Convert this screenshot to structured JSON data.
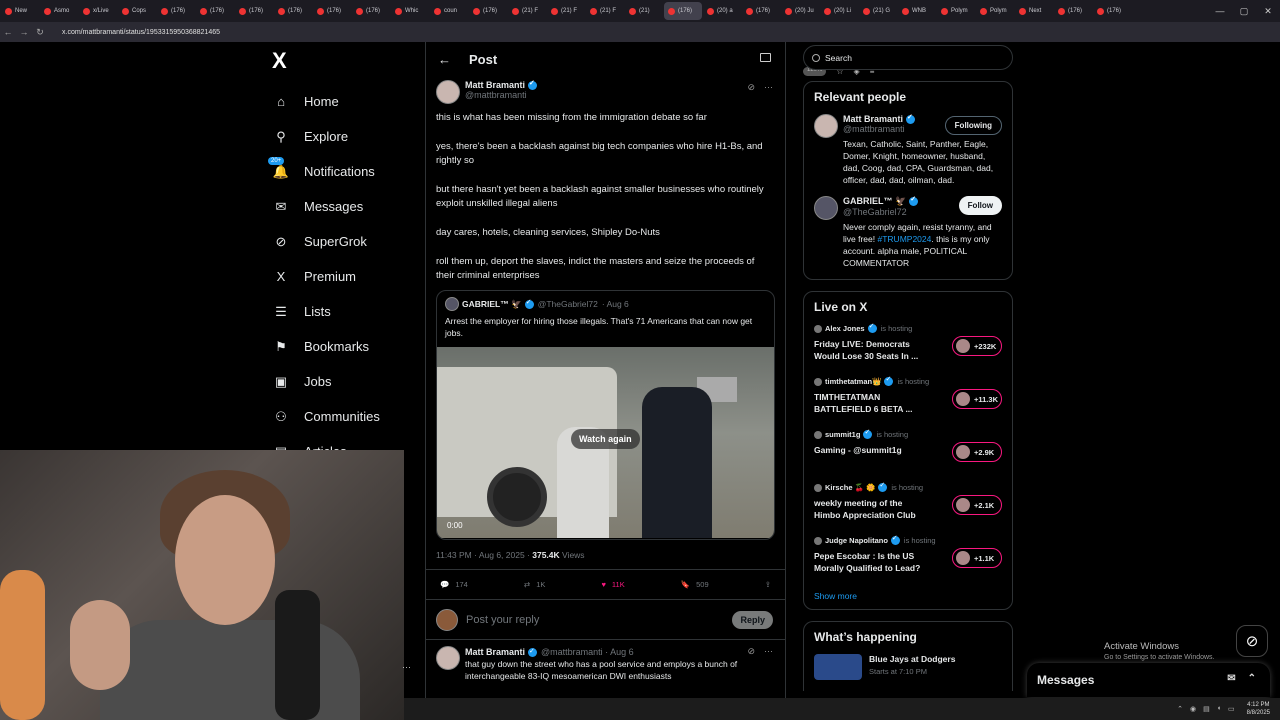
{
  "browser": {
    "tabs": [
      "New",
      "Asmo",
      "x/Live",
      "Cops",
      "(176)",
      "(176)",
      "(176)",
      "(176)",
      "(176)",
      "(176)",
      "Whic",
      "coun",
      "(176)",
      "(21) F",
      "(21) F",
      "(21) F",
      "(21)",
      "(176)",
      "(20) a",
      "(176)",
      "(20) Ju",
      "(20) Li",
      "(21) G",
      "WNB",
      "Polym",
      "Polym",
      "Next",
      "(176)",
      "(176)"
    ],
    "active_tab_index": 17,
    "url": "x.com/mattbramanti/status/1953315950368821465",
    "zoom": "120%"
  },
  "nav": {
    "logo": "X",
    "items": [
      {
        "label": "Home",
        "icon": "home-icon"
      },
      {
        "label": "Explore",
        "icon": "search-icon"
      },
      {
        "label": "Notifications",
        "icon": "bell-icon",
        "badge": "20+"
      },
      {
        "label": "Messages",
        "icon": "envelope-icon"
      },
      {
        "label": "SuperGrok",
        "icon": "grok-icon"
      },
      {
        "label": "Premium",
        "icon": "x-logo-icon"
      },
      {
        "label": "Lists",
        "icon": "list-icon"
      },
      {
        "label": "Bookmarks",
        "icon": "bookmark-icon"
      },
      {
        "label": "Jobs",
        "icon": "briefcase-icon"
      },
      {
        "label": "Communities",
        "icon": "people-icon"
      },
      {
        "label": "Articles",
        "icon": "article-icon"
      }
    ]
  },
  "main": {
    "header_title": "Post",
    "author": {
      "name": "Matt Bramanti",
      "handle": "@mattbramanti"
    },
    "paragraphs": [
      "this is what has been missing from the immigration debate so far",
      "yes, there's been a backlash against big tech companies who hire H1-Bs, and rightly so",
      "but there hasn't yet been a backlash against smaller businesses who routinely exploit unskilled illegal aliens",
      "day cares, hotels, cleaning services, Shipley Do-Nuts",
      "roll them up, deport the slaves, indict the masters and seize the proceeds of their criminal enterprises"
    ],
    "quote": {
      "name": "GABRIEL™ 🦅",
      "handle": "@TheGabriel72",
      "date": "· Aug 6",
      "text": "Arrest the employer for hiring those illegals.  That's 71 Americans that can now get jobs.",
      "video_button": "Watch again",
      "video_time": "0:00"
    },
    "meta": {
      "time": "11:43 PM · Aug 6, 2025 · ",
      "views_count": "375.4K",
      "views_label": " Views"
    },
    "stats": {
      "replies": "174",
      "reposts": "1K",
      "likes": "11K",
      "bookmarks": "509"
    },
    "reply_placeholder": "Post your reply",
    "reply_button": "Reply",
    "reply_post": {
      "name": "Matt Bramanti",
      "handle": "@mattbramanti · Aug 6",
      "text": "that guy down the street who has a pool service and employs a bunch of interchangeable 83-IQ mesoamerican DWI enthusiasts"
    }
  },
  "right": {
    "search_placeholder": "Search",
    "relevant_title": "Relevant people",
    "people": [
      {
        "name": "Matt Bramanti",
        "handle": "@mattbramanti",
        "button": "Following",
        "bio": "Texan, Catholic, Saint, Panther, Eagle, Domer, Knight, homeowner, husband, dad, Coog, dad, CPA, Guardsman, dad, officer, dad, dad, oilman, dad."
      },
      {
        "name": "GABRIEL™ 🦅",
        "handle": "@TheGabriel72",
        "button": "Follow",
        "bio_before": "Never comply again, resist tyranny, and live free! ",
        "bio_tag": "#TRUMP2024",
        "bio_after": ". this is my only account. alpha male, POLITICAL COMMENTATOR"
      }
    ],
    "live_title": "Live on X",
    "live": [
      {
        "host": "Alex Jones",
        "status": "is hosting",
        "title": "Friday LIVE: Democrats Would Lose 30 Seats In ...",
        "count": "+232K"
      },
      {
        "host": "timthetatman👑",
        "status": "is hosting",
        "title": "TIMTHETATMAN BATTLEFIELD 6 BETA ...",
        "count": "+11.3K"
      },
      {
        "host": "summit1g",
        "status": "is hosting",
        "title": "Gaming - @summit1g",
        "count": "+2.9K"
      },
      {
        "host": "Kirsche 🍒 🌼",
        "status": "is hosting",
        "title": "weekly meeting of the Himbo Appreciation Club",
        "count": "+2.1K"
      },
      {
        "host": "Judge Napolitano",
        "status": "is hosting",
        "title": "Pepe Escobar : Is the US Morally Qualified to Lead?",
        "count": "+1.1K"
      }
    ],
    "show_more": "Show more",
    "happening_title": "What’s happening",
    "happening_item": {
      "title": "Blue Jays at Dodgers",
      "sub": "Starts at 7:10 PM"
    }
  },
  "overlay": {
    "activate_title": "Activate Windows",
    "activate_sub": "Go to Settings to activate Windows.",
    "messages_drawer": "Messages",
    "clock_time": "4:12 PM",
    "clock_date": "8/8/2025"
  },
  "colors": {
    "accent": "#1d9bf0",
    "like": "#f91880",
    "background": "#000000",
    "border": "#2f3336"
  }
}
